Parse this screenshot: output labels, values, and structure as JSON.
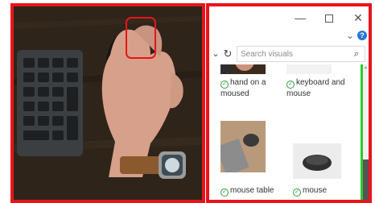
{
  "window": {
    "minimize_glyph": "—",
    "close_glyph": "✕"
  },
  "toolbar": {
    "search_placeholder": "Search visuals"
  },
  "visuals": [
    {
      "caption": "hand on a moused"
    },
    {
      "caption": "keyboard and mouse"
    },
    {
      "caption": "mouse table"
    },
    {
      "caption": "mouse"
    }
  ],
  "colors": {
    "highlight_border": "#e8141a",
    "scrollbar_accent": "#29cc2e",
    "check_green": "#2e9d3c"
  },
  "icons": {
    "refresh": "refresh-icon",
    "search": "search-icon",
    "check": "check-icon",
    "help": "help-icon"
  }
}
